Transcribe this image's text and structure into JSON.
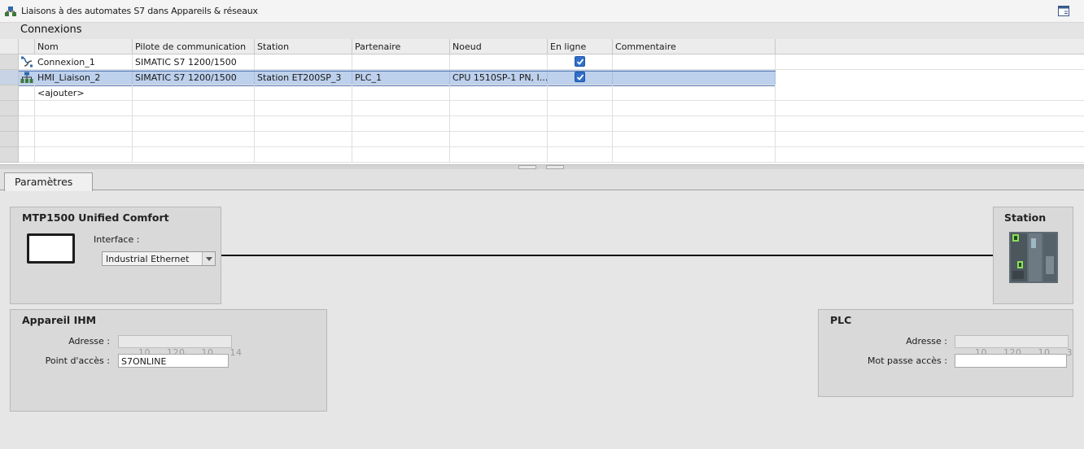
{
  "window": {
    "title": "Liaisons à des automates S7 dans Appareils & réseaux",
    "app_icon": "network-devices-icon",
    "restore_icon": "window-restore-icon"
  },
  "connections": {
    "section_title": "Connexions",
    "columns": [
      "Nom",
      "Pilote de communication",
      "Station",
      "Partenaire",
      "Noeud",
      "En ligne",
      "Commentaire"
    ],
    "rows": [
      {
        "icon": "s7-connection-icon",
        "name": "Connexion_1",
        "driver": "SIMATIC S7 1200/1500",
        "station": "",
        "partner": "",
        "node": "",
        "online": true,
        "comment": ""
      },
      {
        "icon": "hmi-connection-icon",
        "name": "HMI_Liaison_2",
        "driver": "SIMATIC S7 1200/1500",
        "station": "Station ET200SP_3",
        "partner": "PLC_1",
        "node": "CPU 1510SP-1 PN, I...",
        "online": true,
        "comment": ""
      }
    ],
    "add_label": "<ajouter>"
  },
  "tabs": {
    "params": "Paramètres"
  },
  "hmi_device": {
    "title": "MTP1500 Unified Comfort",
    "interface_label": "Interface :",
    "interface_value": "Industrial Ethernet"
  },
  "station": {
    "title": "Station"
  },
  "hmi_params": {
    "title": "Appareil IHM",
    "address_label": "Adresse :",
    "address": [
      "10",
      "120",
      "10",
      "14"
    ],
    "access_point_label": "Point d'accès :",
    "access_point": "S7ONLINE"
  },
  "plc_params": {
    "title": "PLC",
    "address_label": "Adresse :",
    "address": [
      "10",
      "120",
      "10",
      "3"
    ],
    "password_label": "Mot passe accès :",
    "password": ""
  },
  "colors": {
    "selection": "#bdd0ec",
    "checkbox": "#2f6fc9",
    "panel": "#d9d9d9"
  }
}
